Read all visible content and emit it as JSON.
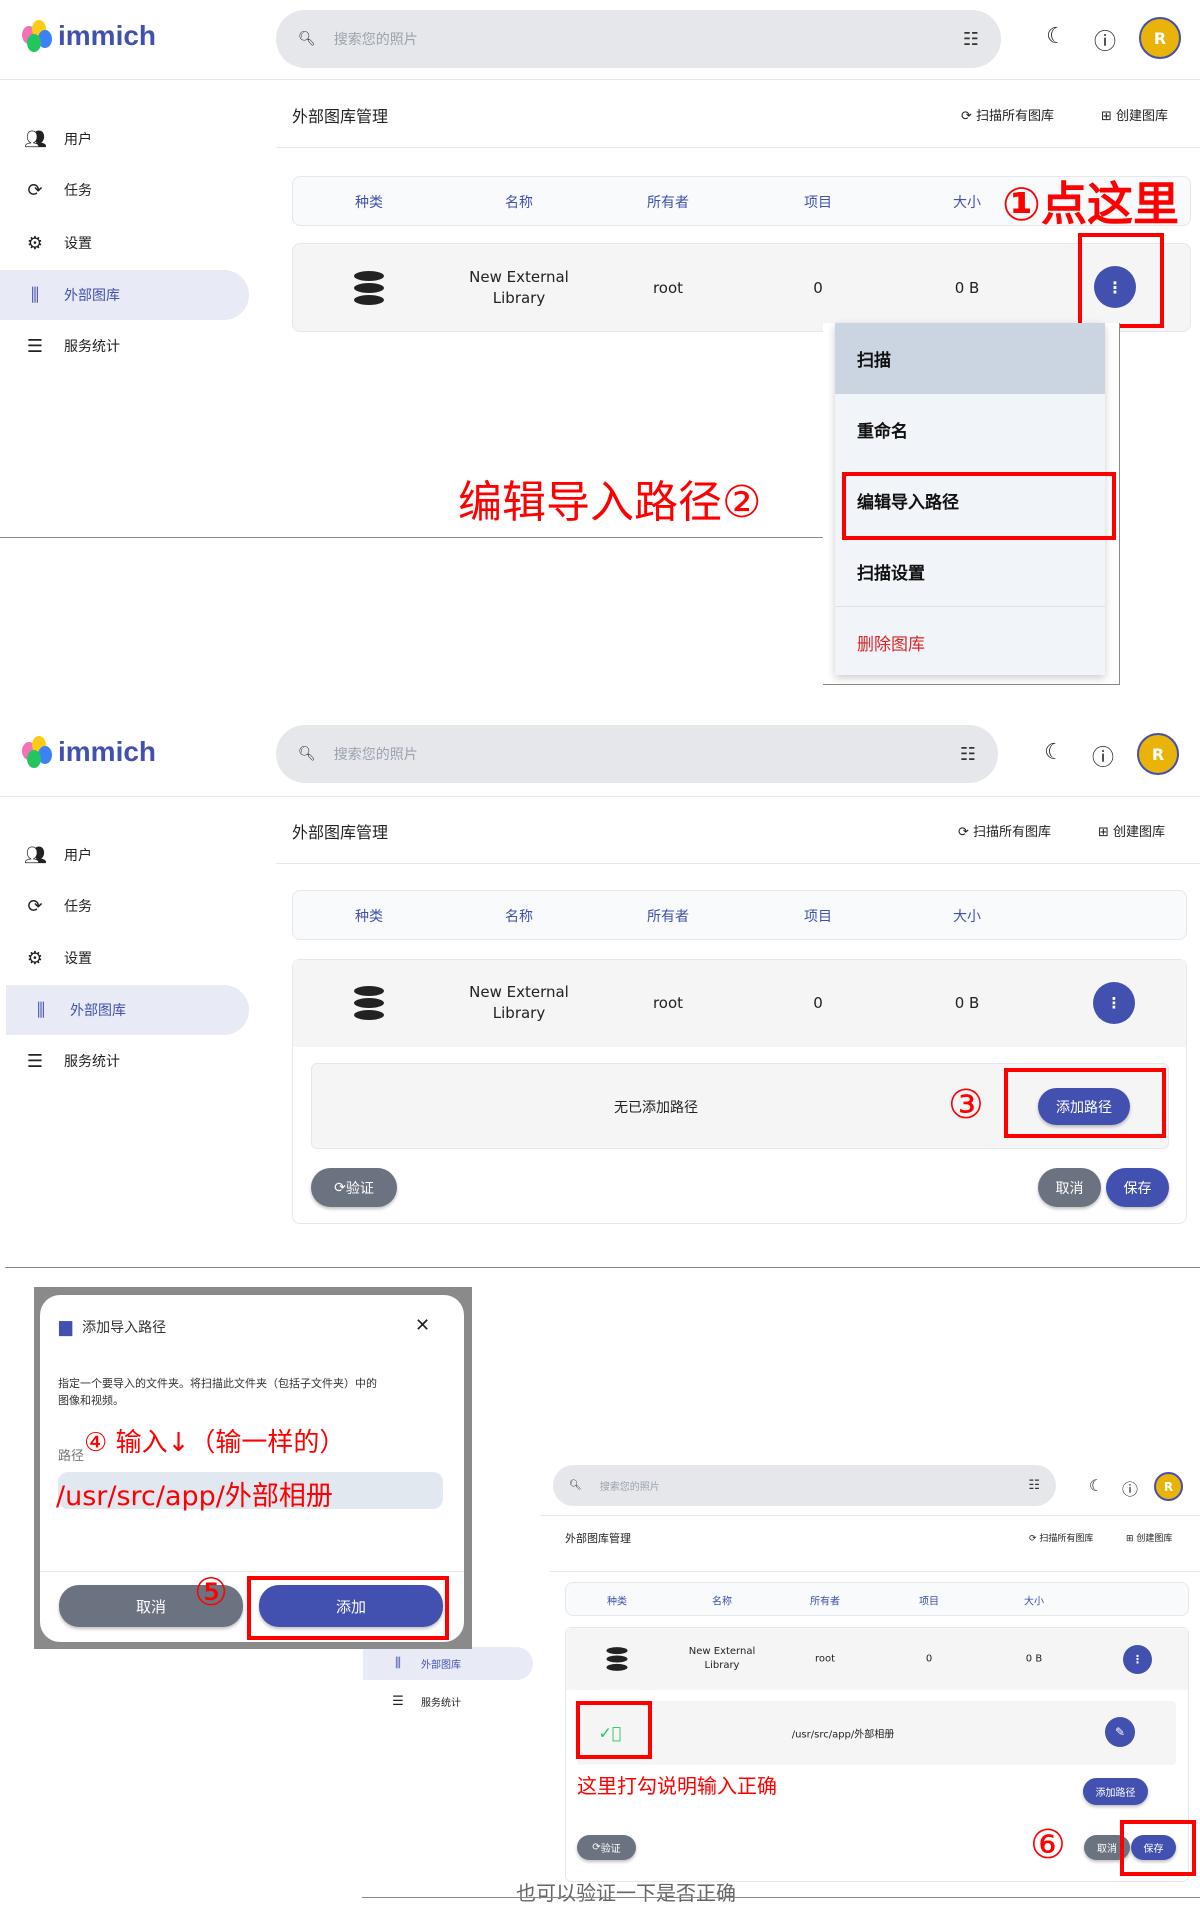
{
  "app": {
    "logo_text": "immich",
    "search_placeholder": "搜索您的照片",
    "avatar_initial": "R"
  },
  "sidebar": {
    "items": [
      {
        "label": "用户",
        "icon": "users-icon"
      },
      {
        "label": "任务",
        "icon": "sync-icon"
      },
      {
        "label": "设置",
        "icon": "gear-icon"
      },
      {
        "label": "外部图库",
        "icon": "library-icon",
        "active": true
      },
      {
        "label": "服务统计",
        "icon": "server-icon"
      }
    ]
  },
  "page": {
    "title": "外部图库管理",
    "scan_all": "扫描所有图库",
    "create": "创建图库"
  },
  "table": {
    "headers": [
      "种类",
      "名称",
      "所有者",
      "项目",
      "大小"
    ],
    "row": {
      "name_line1": "New External",
      "name_line2": "Library",
      "owner": "root",
      "items": "0",
      "size": "0 B"
    }
  },
  "menu": {
    "items": [
      "扫描",
      "重命名",
      "编辑导入路径",
      "扫描设置",
      "删除图库"
    ]
  },
  "edit": {
    "empty": "无已添加路径",
    "add_path": "添加路径",
    "validate": "验证",
    "cancel": "取消",
    "save": "保存",
    "path": "/usr/src/app/外部相册"
  },
  "dialog": {
    "title": "添加导入路径",
    "desc1": "指定一个要导入的文件夹。将扫描此文件夹（包括子文件夹）中的",
    "desc2": "图像和视频。",
    "field_label": "路径",
    "value": "/usr/src/app/外部相册",
    "cancel": "取消",
    "add": "添加"
  },
  "annotations": {
    "a1": "①点这里",
    "a2": "编辑导入路径②",
    "a3": "③",
    "a4": "④ 输入↓（输一样的）",
    "a5": "⑤",
    "a6": "⑥",
    "check_note": "这里打勾说明输入正确",
    "caption": "也可以验证一下是否正确"
  },
  "colors": {
    "primary": "#4250af",
    "annotation": "#ff0000",
    "danger": "#dc2626",
    "success": "#22c55e"
  }
}
